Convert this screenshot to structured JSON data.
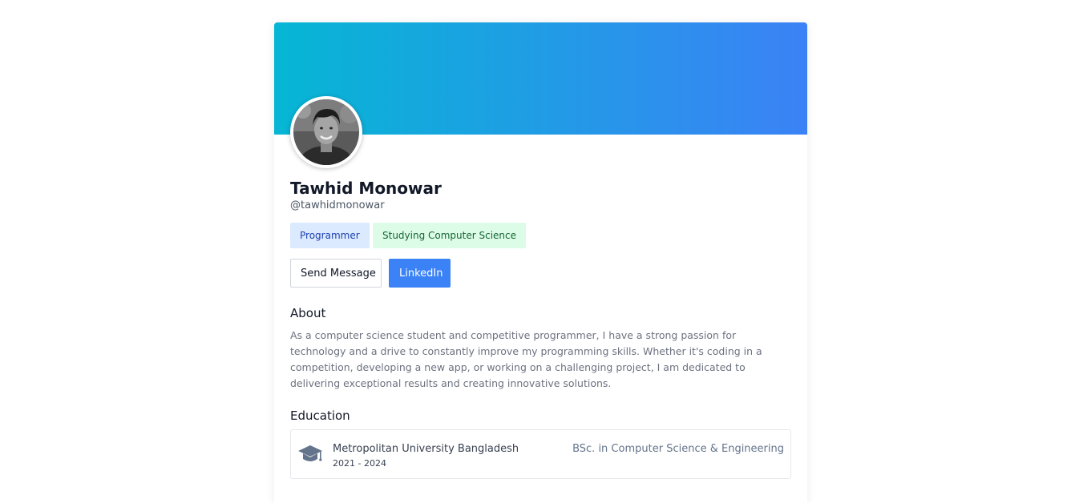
{
  "profile": {
    "name": "Tawhid Monowar",
    "handle": "@tawhidmonowar",
    "avatar_icon": "profile-photo",
    "badges": [
      "Programmer",
      "Studying Computer Science"
    ]
  },
  "actions": {
    "message_label": "Send Message",
    "linkedin_label": "LinkedIn"
  },
  "about": {
    "title": "About",
    "text": "As a computer science student and competitive programmer, I have a strong passion for technology and a drive to constantly improve my programming skills. Whether it's coding in a competition, developing a new app, or working on a challenging project, I am dedicated to delivering exceptional results and creating innovative solutions."
  },
  "education": {
    "title": "Education",
    "items": [
      {
        "icon": "graduation-cap-icon",
        "institution": "Metropolitan University Bangladesh",
        "years": "2021 - 2024",
        "degree": "BSc. in Computer Science & Engineering"
      }
    ]
  },
  "colors": {
    "banner_start": "#06b6d4",
    "banner_end": "#3b82f6",
    "primary": "#3b82f6",
    "badge_blue_bg": "#dbeafe",
    "badge_green_bg": "#dcfce7"
  }
}
